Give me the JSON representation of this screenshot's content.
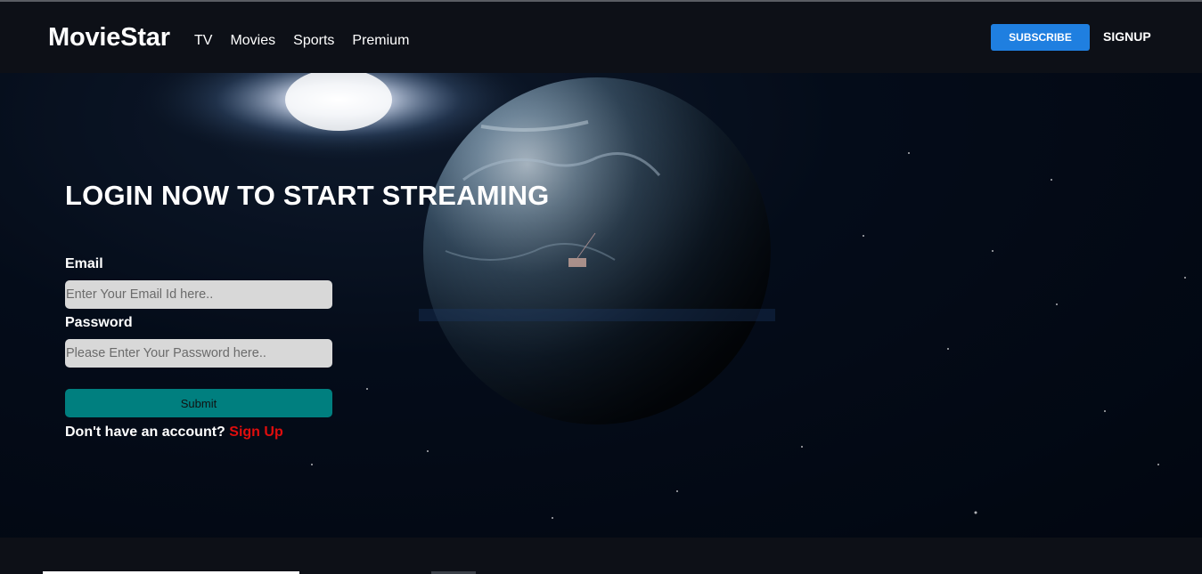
{
  "nav": {
    "brand": "MovieStar",
    "links": [
      "TV",
      "Movies",
      "Sports",
      "Premium"
    ],
    "subscribe_label": "SUBSCRIBE",
    "signup_label": "SIGNUP"
  },
  "hero": {
    "title": "LOGIN NOW TO START STREAMING"
  },
  "form": {
    "email_label": "Email",
    "email_placeholder": "Enter Your Email Id here..",
    "password_label": "Password",
    "password_placeholder": "Please Enter Your Password here..",
    "submit_label": "Submit",
    "account_prompt": "Don't have an account?",
    "signup_link": "Sign Up"
  },
  "colors": {
    "nav_bg": "#0d1017",
    "subscribe_bg": "#1f7fe0",
    "submit_bg": "#007f7f",
    "input_bg": "#d8d8d8",
    "signup_link": "#e00d0d"
  }
}
